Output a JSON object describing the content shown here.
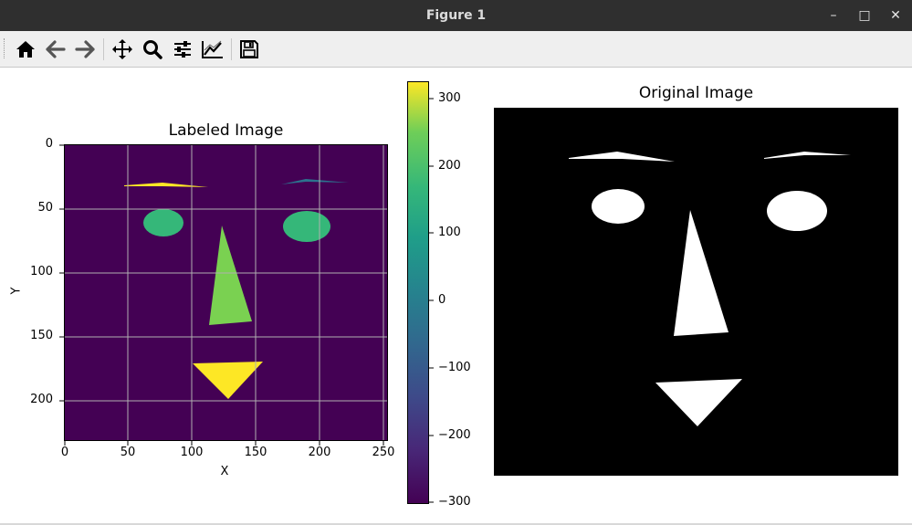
{
  "window": {
    "title": "Figure 1",
    "minimize_glyph": "–",
    "maximize_glyph": "□",
    "close_glyph": "✕"
  },
  "toolbar": {
    "buttons": [
      {
        "name": "home-icon",
        "tooltip": "Home"
      },
      {
        "name": "back-arrow-icon",
        "tooltip": "Back"
      },
      {
        "name": "forward-arrow-icon",
        "tooltip": "Forward"
      },
      {
        "name": "pan-icon",
        "tooltip": "Pan"
      },
      {
        "name": "zoom-icon",
        "tooltip": "Zoom"
      },
      {
        "name": "subplots-icon",
        "tooltip": "Subplots"
      },
      {
        "name": "edit-axis-icon",
        "tooltip": "Customize"
      },
      {
        "name": "save-icon",
        "tooltip": "Save"
      }
    ]
  },
  "labeled": {
    "title": "Labeled Image",
    "xlabel": "X",
    "ylabel": "Y",
    "xticks": [
      "0",
      "50",
      "100",
      "150",
      "200",
      "250"
    ],
    "yticks": [
      "0",
      "50",
      "100",
      "150",
      "200"
    ]
  },
  "colorbar": {
    "ticks": [
      "300",
      "200",
      "100",
      "0",
      "−100",
      "−200",
      "−300"
    ]
  },
  "original": {
    "title": "Original Image"
  },
  "colors": {
    "background_purple": "#440154",
    "yellow": "#fde725",
    "green_light": "#7ad151",
    "green_eye": "#35b779",
    "teal_brow": "#2c728e",
    "grid": "#b0b0b0",
    "titlebar": "#2f2f2f"
  },
  "chart_data": {
    "type": "heatmap",
    "title": "Labeled Image",
    "xlabel": "X",
    "ylabel": "Y",
    "xlim": [
      0,
      253
    ],
    "ylim": [
      230,
      0
    ],
    "colorbar_range": [
      -300,
      330
    ],
    "colormap": "viridis",
    "regions": [
      {
        "name": "left-brow",
        "value": 325
      },
      {
        "name": "right-brow",
        "value": 0
      },
      {
        "name": "left-eye",
        "value": 185
      },
      {
        "name": "right-eye",
        "value": 185
      },
      {
        "name": "nose",
        "value": 230
      },
      {
        "name": "mouth",
        "value": 325
      }
    ]
  }
}
